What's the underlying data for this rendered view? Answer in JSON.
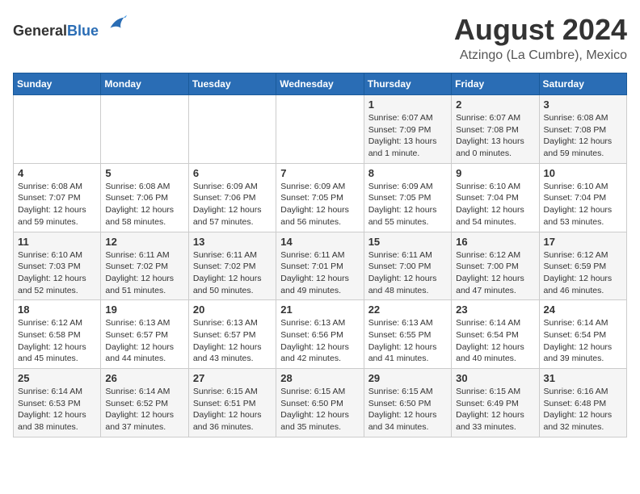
{
  "header": {
    "logo_general": "General",
    "logo_blue": "Blue",
    "month_year": "August 2024",
    "location": "Atzingo (La Cumbre), Mexico"
  },
  "weekdays": [
    "Sunday",
    "Monday",
    "Tuesday",
    "Wednesday",
    "Thursday",
    "Friday",
    "Saturday"
  ],
  "weeks": [
    [
      {
        "day": "",
        "info": ""
      },
      {
        "day": "",
        "info": ""
      },
      {
        "day": "",
        "info": ""
      },
      {
        "day": "",
        "info": ""
      },
      {
        "day": "1",
        "info": "Sunrise: 6:07 AM\nSunset: 7:09 PM\nDaylight: 13 hours\nand 1 minute."
      },
      {
        "day": "2",
        "info": "Sunrise: 6:07 AM\nSunset: 7:08 PM\nDaylight: 13 hours\nand 0 minutes."
      },
      {
        "day": "3",
        "info": "Sunrise: 6:08 AM\nSunset: 7:08 PM\nDaylight: 12 hours\nand 59 minutes."
      }
    ],
    [
      {
        "day": "4",
        "info": "Sunrise: 6:08 AM\nSunset: 7:07 PM\nDaylight: 12 hours\nand 59 minutes."
      },
      {
        "day": "5",
        "info": "Sunrise: 6:08 AM\nSunset: 7:06 PM\nDaylight: 12 hours\nand 58 minutes."
      },
      {
        "day": "6",
        "info": "Sunrise: 6:09 AM\nSunset: 7:06 PM\nDaylight: 12 hours\nand 57 minutes."
      },
      {
        "day": "7",
        "info": "Sunrise: 6:09 AM\nSunset: 7:05 PM\nDaylight: 12 hours\nand 56 minutes."
      },
      {
        "day": "8",
        "info": "Sunrise: 6:09 AM\nSunset: 7:05 PM\nDaylight: 12 hours\nand 55 minutes."
      },
      {
        "day": "9",
        "info": "Sunrise: 6:10 AM\nSunset: 7:04 PM\nDaylight: 12 hours\nand 54 minutes."
      },
      {
        "day": "10",
        "info": "Sunrise: 6:10 AM\nSunset: 7:04 PM\nDaylight: 12 hours\nand 53 minutes."
      }
    ],
    [
      {
        "day": "11",
        "info": "Sunrise: 6:10 AM\nSunset: 7:03 PM\nDaylight: 12 hours\nand 52 minutes."
      },
      {
        "day": "12",
        "info": "Sunrise: 6:11 AM\nSunset: 7:02 PM\nDaylight: 12 hours\nand 51 minutes."
      },
      {
        "day": "13",
        "info": "Sunrise: 6:11 AM\nSunset: 7:02 PM\nDaylight: 12 hours\nand 50 minutes."
      },
      {
        "day": "14",
        "info": "Sunrise: 6:11 AM\nSunset: 7:01 PM\nDaylight: 12 hours\nand 49 minutes."
      },
      {
        "day": "15",
        "info": "Sunrise: 6:11 AM\nSunset: 7:00 PM\nDaylight: 12 hours\nand 48 minutes."
      },
      {
        "day": "16",
        "info": "Sunrise: 6:12 AM\nSunset: 7:00 PM\nDaylight: 12 hours\nand 47 minutes."
      },
      {
        "day": "17",
        "info": "Sunrise: 6:12 AM\nSunset: 6:59 PM\nDaylight: 12 hours\nand 46 minutes."
      }
    ],
    [
      {
        "day": "18",
        "info": "Sunrise: 6:12 AM\nSunset: 6:58 PM\nDaylight: 12 hours\nand 45 minutes."
      },
      {
        "day": "19",
        "info": "Sunrise: 6:13 AM\nSunset: 6:57 PM\nDaylight: 12 hours\nand 44 minutes."
      },
      {
        "day": "20",
        "info": "Sunrise: 6:13 AM\nSunset: 6:57 PM\nDaylight: 12 hours\nand 43 minutes."
      },
      {
        "day": "21",
        "info": "Sunrise: 6:13 AM\nSunset: 6:56 PM\nDaylight: 12 hours\nand 42 minutes."
      },
      {
        "day": "22",
        "info": "Sunrise: 6:13 AM\nSunset: 6:55 PM\nDaylight: 12 hours\nand 41 minutes."
      },
      {
        "day": "23",
        "info": "Sunrise: 6:14 AM\nSunset: 6:54 PM\nDaylight: 12 hours\nand 40 minutes."
      },
      {
        "day": "24",
        "info": "Sunrise: 6:14 AM\nSunset: 6:54 PM\nDaylight: 12 hours\nand 39 minutes."
      }
    ],
    [
      {
        "day": "25",
        "info": "Sunrise: 6:14 AM\nSunset: 6:53 PM\nDaylight: 12 hours\nand 38 minutes."
      },
      {
        "day": "26",
        "info": "Sunrise: 6:14 AM\nSunset: 6:52 PM\nDaylight: 12 hours\nand 37 minutes."
      },
      {
        "day": "27",
        "info": "Sunrise: 6:15 AM\nSunset: 6:51 PM\nDaylight: 12 hours\nand 36 minutes."
      },
      {
        "day": "28",
        "info": "Sunrise: 6:15 AM\nSunset: 6:50 PM\nDaylight: 12 hours\nand 35 minutes."
      },
      {
        "day": "29",
        "info": "Sunrise: 6:15 AM\nSunset: 6:50 PM\nDaylight: 12 hours\nand 34 minutes."
      },
      {
        "day": "30",
        "info": "Sunrise: 6:15 AM\nSunset: 6:49 PM\nDaylight: 12 hours\nand 33 minutes."
      },
      {
        "day": "31",
        "info": "Sunrise: 6:16 AM\nSunset: 6:48 PM\nDaylight: 12 hours\nand 32 minutes."
      }
    ]
  ]
}
